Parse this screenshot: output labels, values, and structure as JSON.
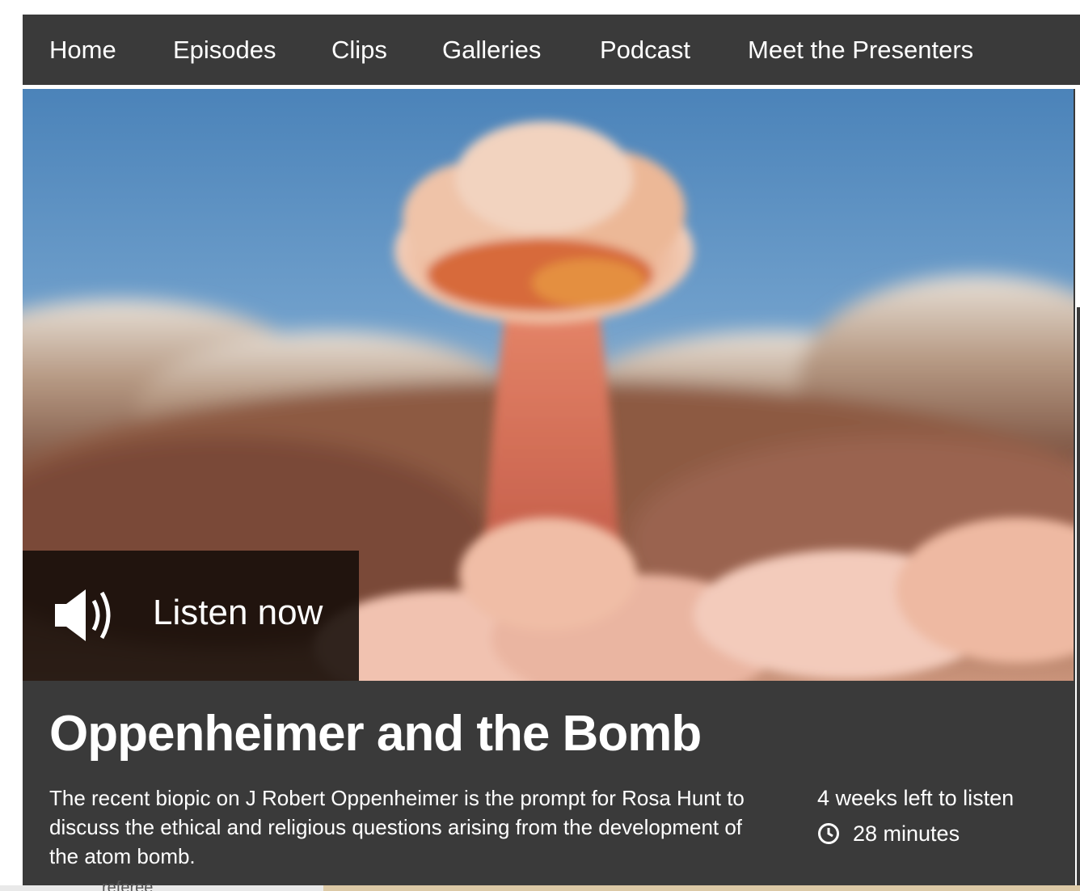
{
  "nav": {
    "items": [
      {
        "label": "Home"
      },
      {
        "label": "Episodes"
      },
      {
        "label": "Clips"
      },
      {
        "label": "Galleries"
      },
      {
        "label": "Podcast"
      },
      {
        "label": "Meet the Presenters"
      }
    ]
  },
  "hero": {
    "image_subject": "mushroom-cloud-illustration",
    "listen_label": "Listen now",
    "icon": "speaker-icon"
  },
  "episode": {
    "title": "Oppenheimer and the Bomb",
    "description": "The recent biopic on J Robert Oppenheimer is the prompt for Rosa Hunt to discuss the ethical and religious questions arising from the development of the atom bomb.",
    "availability": "4 weeks left to listen",
    "duration": "28 minutes",
    "duration_icon": "clock-icon"
  },
  "colors": {
    "bar_background": "#3a3a3a",
    "text": "#ffffff",
    "listen_overlay": "#140c08"
  },
  "bottom_strip": {
    "partial_text": "referee"
  }
}
